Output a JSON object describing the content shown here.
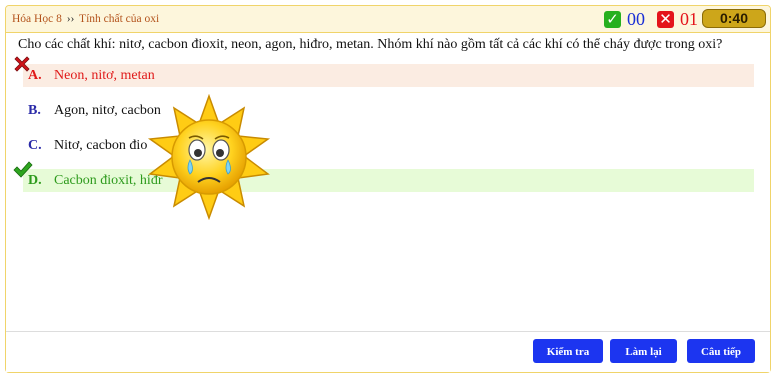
{
  "header": {
    "breadcrumb": [
      "Hóa Học 8",
      "Tính chất của oxi"
    ],
    "breadcrumb_sep": "››",
    "correct_count": "00",
    "wrong_count": "01",
    "timer": "0:40"
  },
  "question": "Cho các chất khí: nitơ, cacbon đioxit, neon, agon, hiđro, metan. Nhóm khí nào gồm tất cả các khí có thể cháy được trong oxi?",
  "options": [
    {
      "letter": "A.",
      "text": "Neon, nitơ, metan",
      "state": "wrong"
    },
    {
      "letter": "B.",
      "text": "Agon, nitơ, cacbon",
      "state": "plain"
    },
    {
      "letter": "C.",
      "text": "Nitơ, cacbon đio",
      "state": "plain"
    },
    {
      "letter": "D.",
      "text": "Cacbon đioxit, hiđr",
      "state": "correct"
    }
  ],
  "footer": {
    "check_label": "Kiểm tra",
    "retry_label": "Làm lại",
    "next_label": "Câu tiếp"
  },
  "colors": {
    "wrong_bg": "#fbece2",
    "wrong_text": "#e01a1a",
    "correct_bg": "#e7fbd7",
    "correct_text": "#2d9a1c",
    "button": "#1c35f0",
    "timer": "#cda61a"
  },
  "icons": {
    "correct_box": "check-icon",
    "wrong_box": "x-icon",
    "wrong_mark": "red-x-icon",
    "correct_mark": "green-check-icon",
    "feedback": "crying-sun-emoticon"
  }
}
